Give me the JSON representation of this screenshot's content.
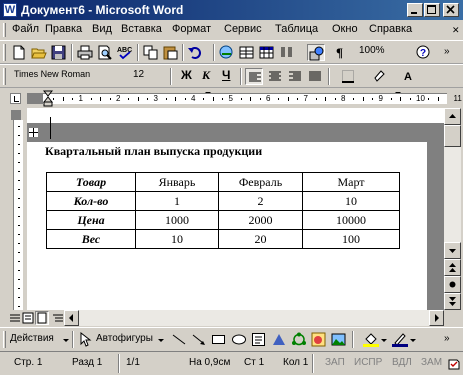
{
  "window": {
    "title": "Документ6 - Microsoft Word",
    "app_icon": "W"
  },
  "menu": {
    "items": [
      "Файл",
      "Правка",
      "Вид",
      "Вставка",
      "Формат",
      "Сервис",
      "Таблица",
      "Окно",
      "Справка"
    ]
  },
  "standard_toolbar": {
    "zoom": "100%"
  },
  "formatting_toolbar": {
    "font": "Times New Roman",
    "size": "12",
    "bold": "Ж",
    "italic": "К",
    "underline": "Ч",
    "highlight_color": "#ffff00",
    "font_color": "#ff0000"
  },
  "ruler": {
    "numbers": [
      "1",
      "2",
      "3",
      "4",
      "5",
      "6",
      "7",
      "8",
      "9",
      "10",
      "11"
    ]
  },
  "document": {
    "title": "Квартальный план выпуска продукции",
    "table": {
      "headers": [
        "Товар",
        "Январь",
        "Февраль",
        "Март"
      ],
      "rows": [
        [
          "Кол-во",
          "1",
          "2",
          "10"
        ],
        [
          "Цена",
          "1000",
          "2000",
          "10000"
        ],
        [
          "Вес",
          "10",
          "20",
          "100"
        ]
      ]
    }
  },
  "drawing_toolbar": {
    "draw": "Действия",
    "autoshapes": "Автофигуры"
  },
  "status": {
    "page": "Стр. 1",
    "section": "Разд 1",
    "pages": "1/1",
    "position": "На 0,9см",
    "line": "Ст 1",
    "column": "Кол 1",
    "rec": "ЗАП",
    "trk": "ИСПР",
    "ext": "ВДЛ",
    "ovr": "ЗАМ"
  }
}
